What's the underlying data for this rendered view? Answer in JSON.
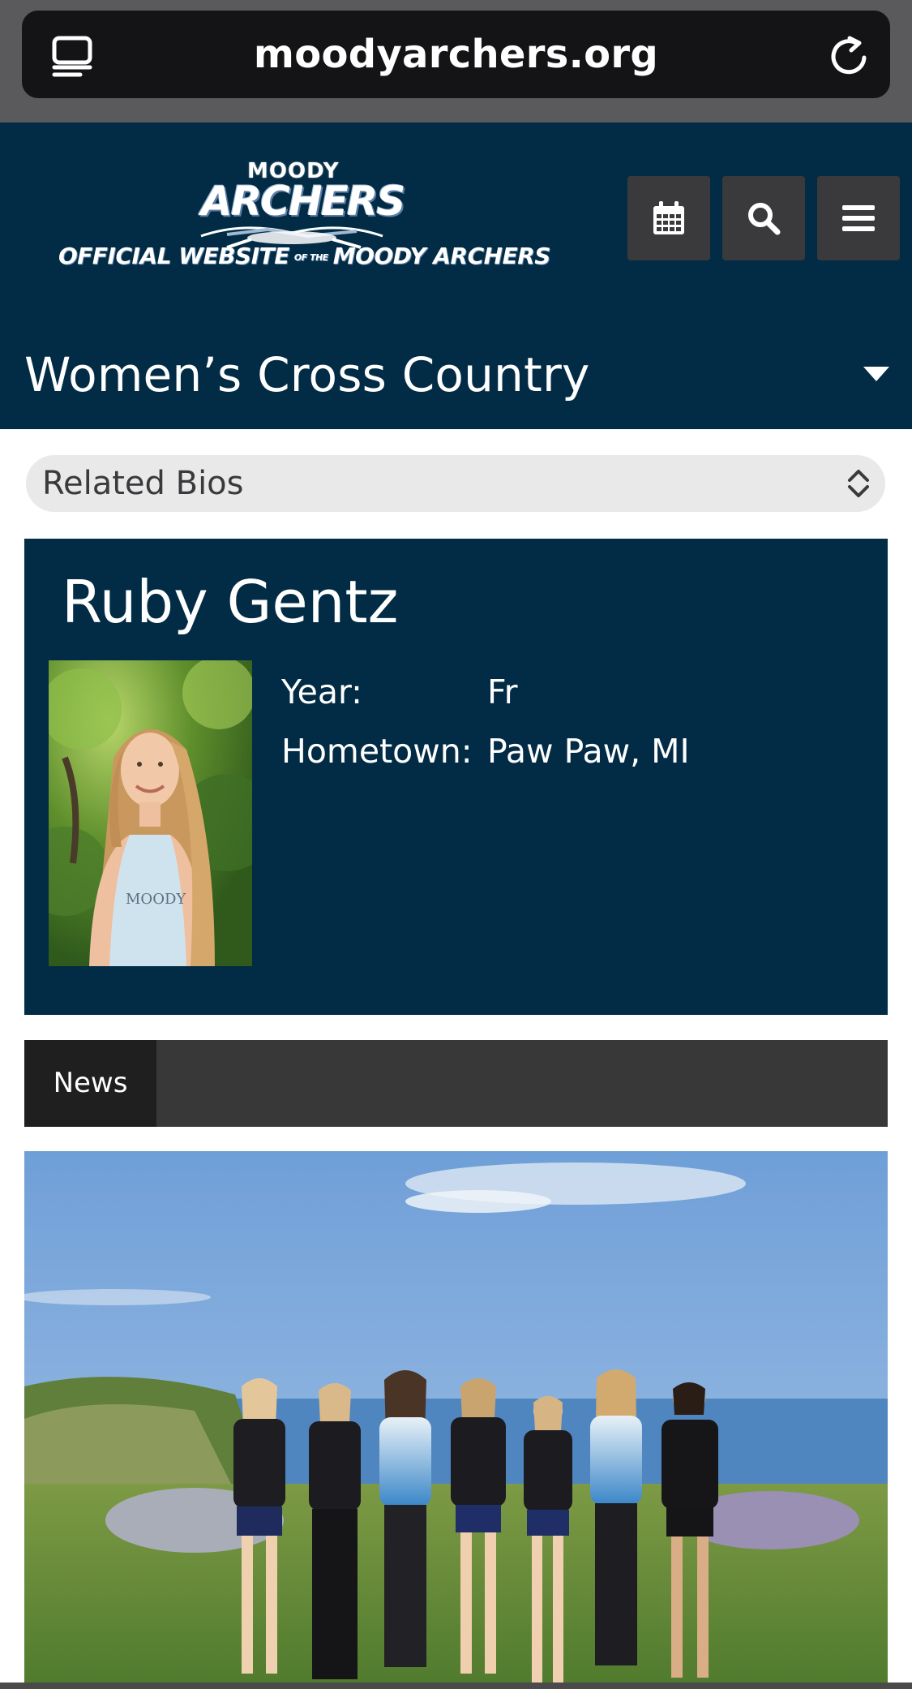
{
  "browser": {
    "url": "moodyarchers.org"
  },
  "header": {
    "logo_top": "MOODY",
    "logo_main": "ARCHERS",
    "logo_tagline_left": "OFFICIAL WEBSITE",
    "logo_tagline_mid": "OF THE",
    "logo_tagline_right": "MOODY ARCHERS",
    "sport_title": "Women’s Cross Country",
    "icons": [
      "calendar-icon",
      "search-icon",
      "menu-icon"
    ]
  },
  "related_bios": {
    "selected": "Related Bios"
  },
  "bio": {
    "name": "Ruby Gentz",
    "fields": [
      {
        "label": "Year:",
        "value": "Fr"
      },
      {
        "label": "Hometown:",
        "value": "Paw Paw, MI"
      }
    ]
  },
  "news": {
    "tab_label": "News"
  },
  "colors": {
    "navy": "#022c45",
    "dark_button": "#3a3a3c",
    "tab_bar": "#383838",
    "tab_active": "#1f1f1f"
  }
}
